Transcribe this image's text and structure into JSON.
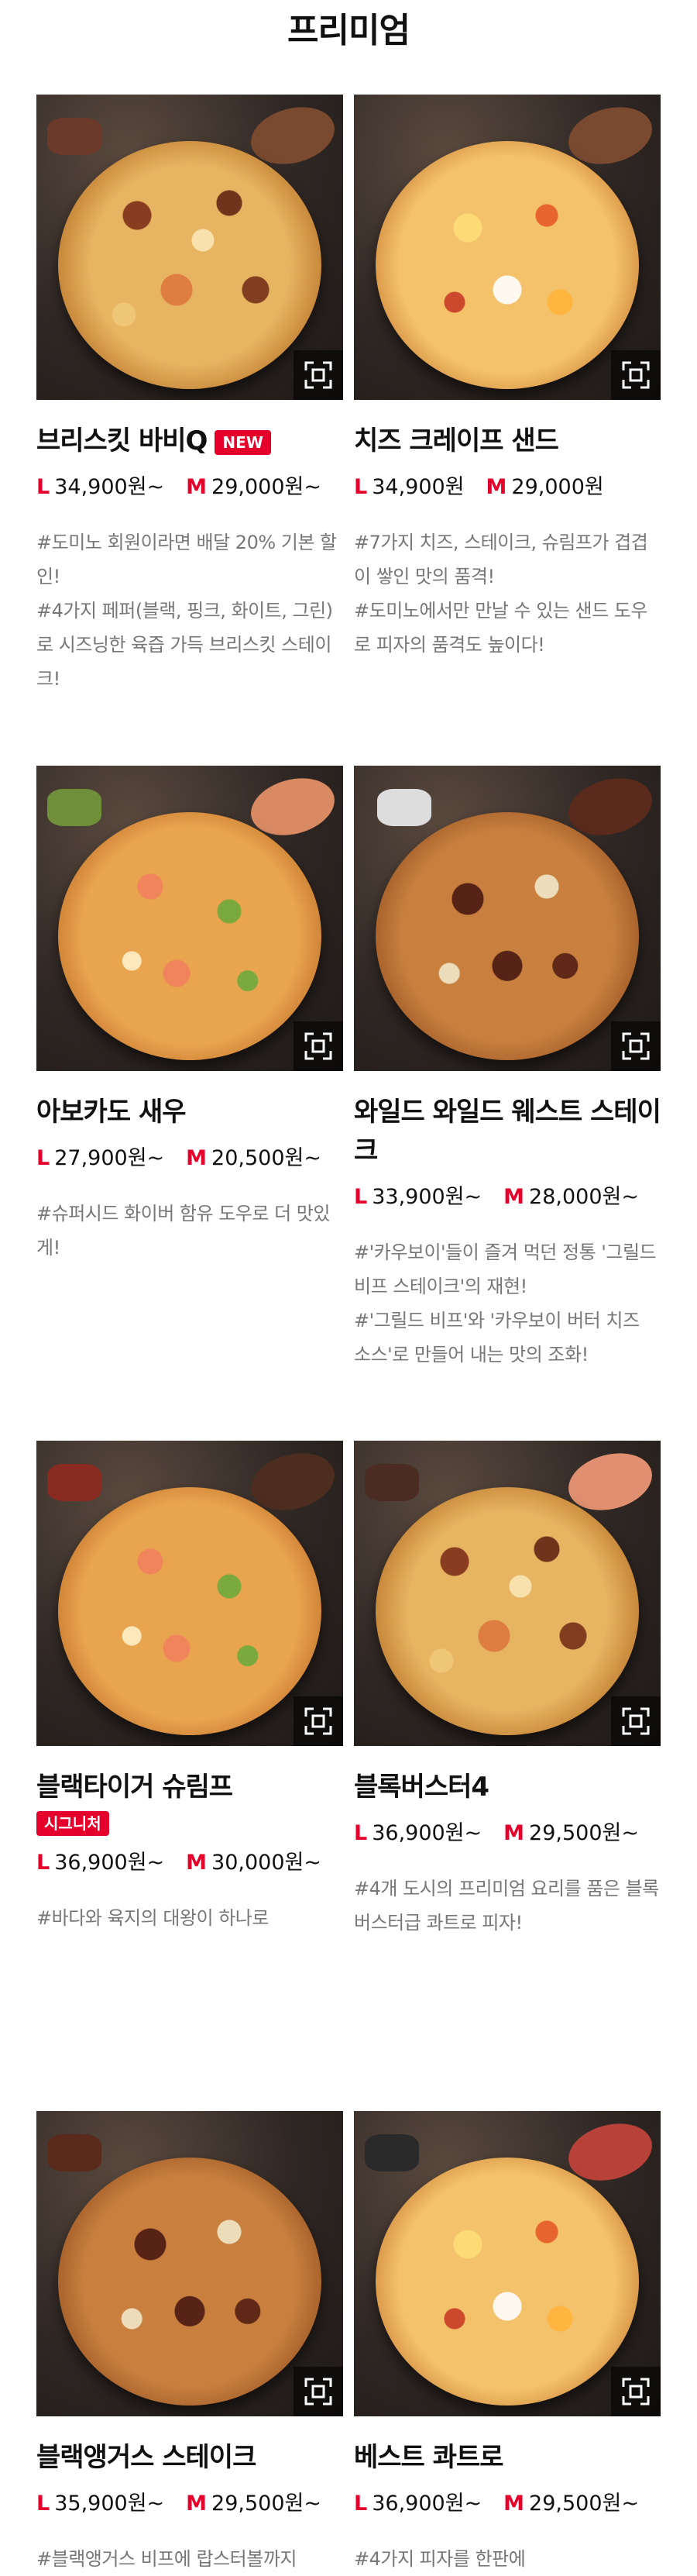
{
  "page": {
    "title": "프리미엄"
  },
  "colors": {
    "accent": "#e4002b",
    "description": "#777777",
    "zoom_overlay": "#000000"
  },
  "icons": {
    "zoom": "zoom-expand-icon"
  },
  "products": [
    {
      "name": "브리스킷 바비Q",
      "badge": "NEW",
      "price_l": "34,900원~",
      "price_m": "29,000원~",
      "desc": [
        "#도미노 회원이라면 배달 20% 기본 할인!",
        "#4가지 페퍼(블랙, 핑크, 화이트, 그린)로 시즈닝한 육즙 가득 브리스킷 스테이크!"
      ]
    },
    {
      "name": "치즈 크레이프 샌드",
      "badge": "",
      "price_l": "34,900원",
      "price_m": "29,000원",
      "desc": [
        "#7가지 치즈, 스테이크, 슈림프가 겹겹이 쌓인 맛의 품격!",
        "#도미노에서만 만날 수 있는 샌드 도우로 피자의 품격도 높이다!"
      ]
    },
    {
      "name": "아보카도 새우",
      "badge": "",
      "price_l": "27,900원~",
      "price_m": "20,500원~",
      "desc": [
        "#슈퍼시드 화이버 함유 도우로 더 맛있게!"
      ]
    },
    {
      "name": "와일드 와일드 웨스트 스테이크",
      "badge": "",
      "price_l": "33,900원~",
      "price_m": "28,000원~",
      "desc": [
        "#'카우보이'들이 즐겨 먹던 정통 '그릴드 비프 스테이크'의 재현!",
        "#'그릴드 비프'와 '카우보이 버터 치즈 소스'로 만들어 내는 맛의 조화!"
      ]
    },
    {
      "name": "블랙타이거 슈림프",
      "badge": "시그니처",
      "price_l": "36,900원~",
      "price_m": "30,000원~",
      "desc": [
        "#바다와 육지의 대왕이 하나로"
      ]
    },
    {
      "name": "블록버스터4",
      "badge": "",
      "price_l": "36,900원~",
      "price_m": "29,500원~",
      "desc": [
        "#4개 도시의 프리미엄 요리를 품은 블록버스터급 콰트로 피자!"
      ]
    },
    {
      "name": "블랙앵거스 스테이크",
      "badge": "",
      "price_l": "35,900원~",
      "price_m": "29,500원~",
      "desc": [
        "#블랙앵거스 비프에 랍스터볼까지"
      ]
    },
    {
      "name": "베스트 콰트로",
      "badge": "",
      "price_l": "36,900원~",
      "price_m": "29,500원~",
      "desc": [
        "#4가지 피자를 한판에"
      ]
    }
  ],
  "labels": {
    "size_l": "L",
    "size_m": "M"
  }
}
